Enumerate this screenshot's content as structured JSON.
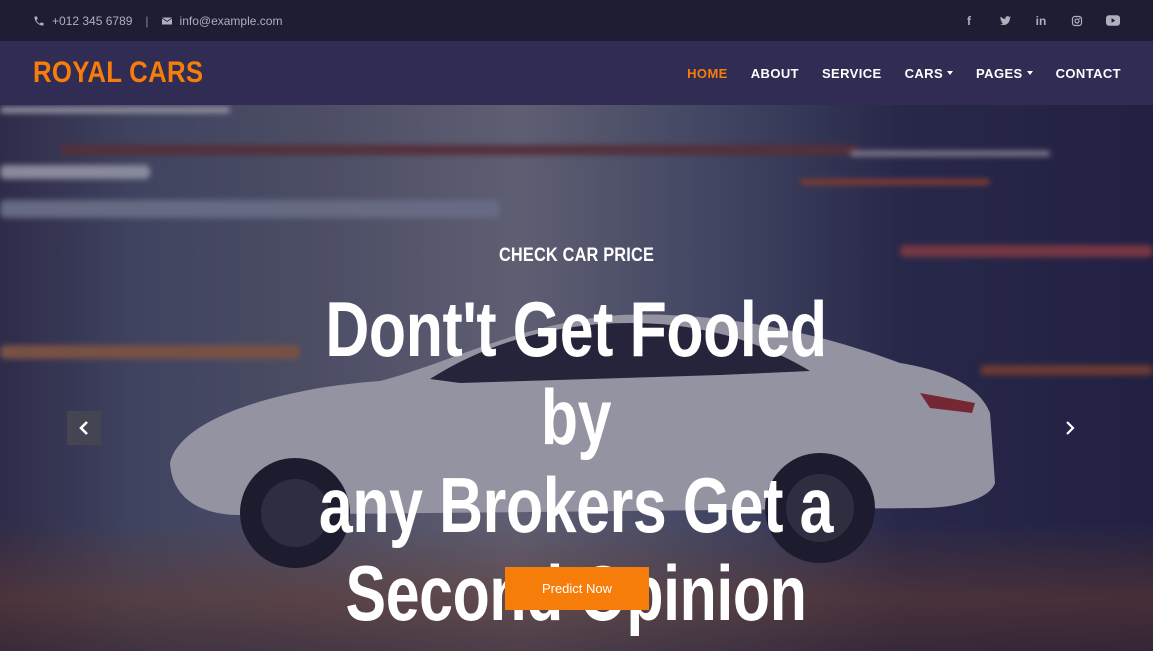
{
  "topbar": {
    "phone": "+012 345 6789",
    "separator": "|",
    "email": "info@example.com",
    "icons": [
      "phone-icon",
      "envelope-icon"
    ],
    "social": [
      "facebook-icon",
      "twitter-icon",
      "linkedin-icon",
      "instagram-icon",
      "youtube-icon"
    ],
    "social_glyphs": {
      "facebook": "f",
      "linkedin": "in"
    }
  },
  "brand": {
    "logo": "ROYAL CARS",
    "accent": "#f77d0a"
  },
  "nav": {
    "items": [
      {
        "label": "HOME",
        "active": true,
        "dropdown": false
      },
      {
        "label": "ABOUT",
        "active": false,
        "dropdown": false
      },
      {
        "label": "SERVICE",
        "active": false,
        "dropdown": false
      },
      {
        "label": "CARS",
        "active": false,
        "dropdown": true
      },
      {
        "label": "PAGES",
        "active": false,
        "dropdown": true
      },
      {
        "label": "CONTACT",
        "active": false,
        "dropdown": false
      }
    ]
  },
  "hero": {
    "subtitle": "CHECK CAR PRICE",
    "title_lines": [
      "Dont't Get Fooled by",
      "any Brokers Get a",
      "Second Opinion"
    ],
    "button": "Predict Now",
    "controls": [
      "chevron-left-icon",
      "chevron-right-icon"
    ]
  }
}
